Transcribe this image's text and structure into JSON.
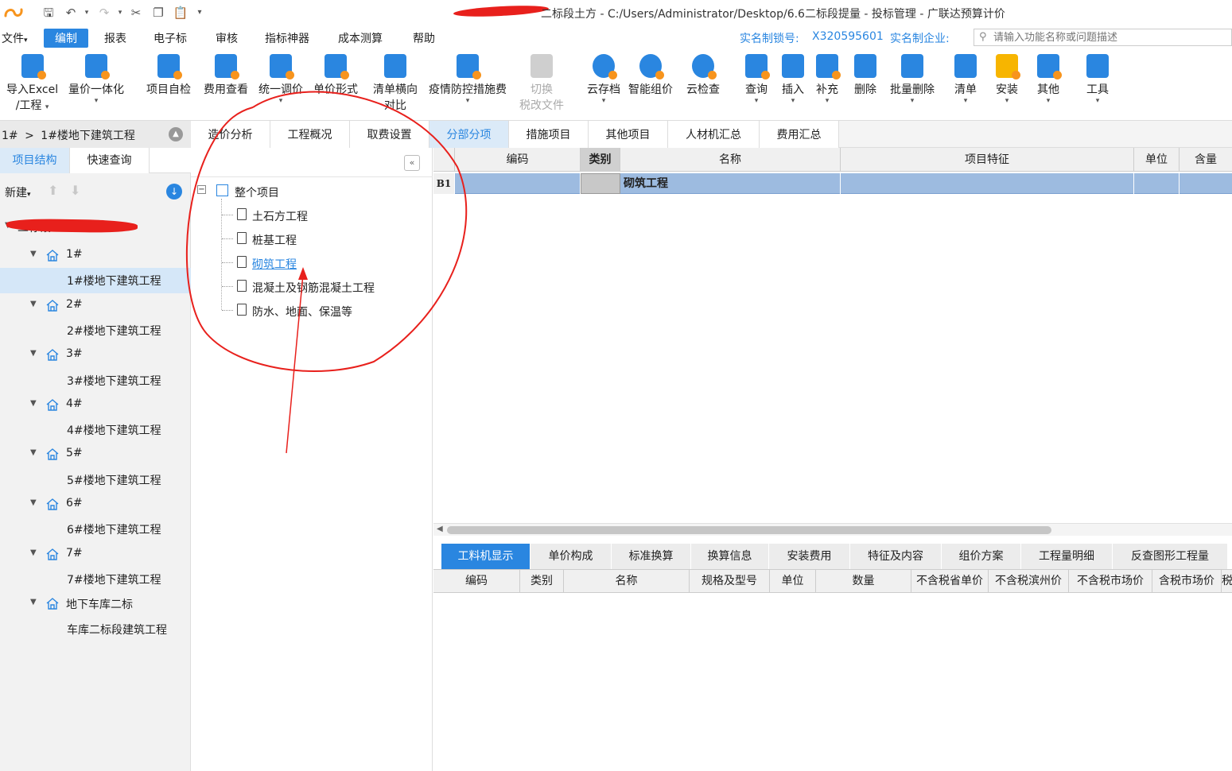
{
  "title": {
    "text": "二标段土方 - C:/Users/Administrator/Desktop/6.6二标段提量 - 投标管理 - 广联达预算计价"
  },
  "menu": {
    "items": [
      "文件",
      "编制",
      "报表",
      "电子标",
      "审核",
      "指标神器",
      "成本测算",
      "帮助"
    ],
    "active_index": 1,
    "auth_lock_label": "实名制锁号:",
    "auth_lock_value": "X320595601",
    "auth_company_label": "实名制企业:",
    "search_placeholder": "请输入功能名称或问题描述"
  },
  "ribbon": {
    "buttons": [
      {
        "label": "导入Excel",
        "label2": "/工程",
        "icon": "import-excel-icon"
      },
      {
        "label": "量价一体化",
        "label2": "",
        "icon": "quantity-price-icon"
      },
      {
        "label": "项目自检",
        "label2": "",
        "icon": "self-check-icon"
      },
      {
        "label": "费用查看",
        "label2": "",
        "icon": "fee-view-icon"
      },
      {
        "label": "统一调价",
        "label2": "",
        "icon": "unified-price-icon"
      },
      {
        "label": "单价形式",
        "label2": "",
        "icon": "unit-price-icon"
      },
      {
        "label": "清单横向",
        "label2": "对比",
        "icon": "list-compare-icon"
      },
      {
        "label": "疫情防控措施费",
        "label2": "",
        "icon": "epidemic-fee-icon"
      },
      {
        "label": "切换",
        "label2": "税改文件",
        "icon": "switch-tax-icon"
      },
      {
        "label": "云存档",
        "label2": "",
        "icon": "cloud-save-icon"
      },
      {
        "label": "智能组价",
        "label2": "",
        "icon": "smart-price-icon"
      },
      {
        "label": "云检查",
        "label2": "",
        "icon": "cloud-check-icon"
      },
      {
        "label": "查询",
        "label2": "",
        "icon": "query-icon"
      },
      {
        "label": "插入",
        "label2": "",
        "icon": "insert-icon"
      },
      {
        "label": "补充",
        "label2": "",
        "icon": "supplement-icon"
      },
      {
        "label": "删除",
        "label2": "",
        "icon": "delete-icon"
      },
      {
        "label": "批量删除",
        "label2": "",
        "icon": "batch-delete-icon"
      },
      {
        "label": "清单",
        "label2": "",
        "icon": "list-icon"
      },
      {
        "label": "安装",
        "label2": "",
        "icon": "install-icon"
      },
      {
        "label": "其他",
        "label2": "",
        "icon": "other-icon"
      },
      {
        "label": "工具",
        "label2": "",
        "icon": "tools-icon"
      }
    ]
  },
  "left": {
    "breadcrumb_root": "1#",
    "breadcrumb_sep": ">",
    "breadcrumb_current": "1#楼地下建筑工程",
    "tabs": [
      "项目结构",
      "快速查询"
    ],
    "new_label": "新建",
    "root_label": "二标段",
    "tree": [
      {
        "type": "unit",
        "label": "1#"
      },
      {
        "type": "leaf",
        "label": "1#楼地下建筑工程"
      },
      {
        "type": "unit",
        "label": "2#"
      },
      {
        "type": "leaf",
        "label": "2#楼地下建筑工程"
      },
      {
        "type": "unit",
        "label": "3#"
      },
      {
        "type": "leaf",
        "label": "3#楼地下建筑工程"
      },
      {
        "type": "unit",
        "label": "4#"
      },
      {
        "type": "leaf",
        "label": "4#楼地下建筑工程"
      },
      {
        "type": "unit",
        "label": "5#"
      },
      {
        "type": "leaf",
        "label": "5#楼地下建筑工程"
      },
      {
        "type": "unit",
        "label": "6#"
      },
      {
        "type": "leaf",
        "label": "6#楼地下建筑工程"
      },
      {
        "type": "unit",
        "label": "7#"
      },
      {
        "type": "leaf",
        "label": "7#楼地下建筑工程"
      },
      {
        "type": "unit",
        "label": "地下车库二标"
      },
      {
        "type": "leaf",
        "label": "车库二标段建筑工程"
      }
    ]
  },
  "main_tabs": [
    "造价分析",
    "工程概况",
    "取费设置",
    "分部分项",
    "措施项目",
    "其他项目",
    "人材机汇总",
    "费用汇总"
  ],
  "main_tab_active": 3,
  "mid_tree": {
    "root": "整个项目",
    "children": [
      "土石方工程",
      "桩基工程",
      "砌筑工程",
      "混凝土及钢筋混凝土工程",
      "防水、地面、保温等"
    ]
  },
  "grid": {
    "headers": [
      "编码",
      "类别",
      "名称",
      "项目特征",
      "单位",
      "含量"
    ],
    "rows": [
      {
        "id": "B1",
        "code": "",
        "category": "",
        "name": "砌筑工程",
        "feature": "",
        "unit": "",
        "qty": ""
      }
    ]
  },
  "bottom": {
    "tabs": [
      "工料机显示",
      "单价构成",
      "标准换算",
      "换算信息",
      "安装费用",
      "特征及内容",
      "组价方案",
      "工程量明细",
      "反查图形工程量"
    ],
    "headers": [
      "编码",
      "类别",
      "名称",
      "规格及型号",
      "单位",
      "数量",
      "不含税省单价",
      "不含税滨州价",
      "不含税市场价",
      "含税市场价",
      "税"
    ]
  },
  "colors": {
    "accent": "#2a86e0",
    "annotation": "#e8201c",
    "selected_row": "#9dbbe0"
  }
}
